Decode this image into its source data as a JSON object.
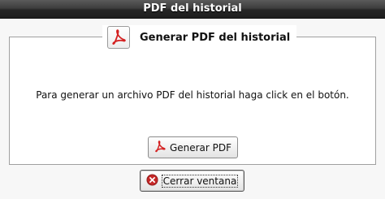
{
  "window": {
    "title": "PDF del historial"
  },
  "panel": {
    "legend_title": "Generar PDF del historial",
    "legend_icon": "pdf-icon",
    "message": "Para generar un archivo PDF del historial haga click en el botón."
  },
  "buttons": {
    "generate_label": "Generar PDF",
    "generate_icon": "pdf-icon",
    "close_label": "Cerrar ventana",
    "close_icon": "close-circle-icon"
  },
  "colors": {
    "pdf_red": "#d42020",
    "close_red": "#c62828"
  }
}
